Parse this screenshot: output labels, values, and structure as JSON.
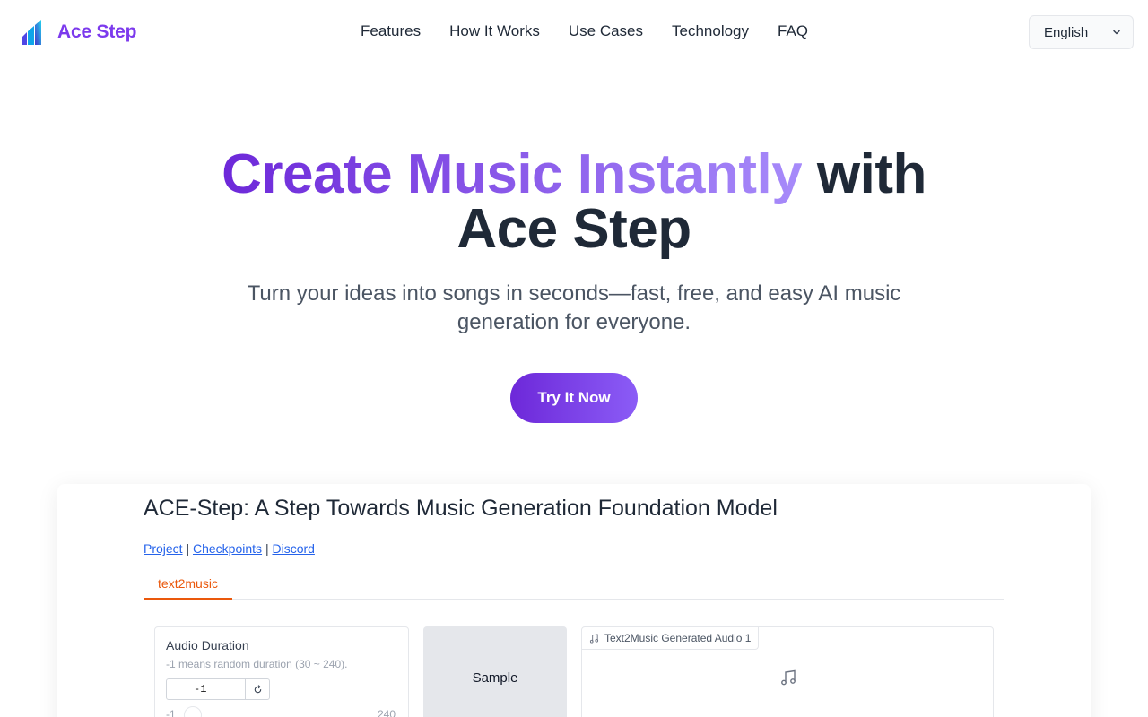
{
  "brand": {
    "name": "Ace Step"
  },
  "nav": {
    "links": [
      "Features",
      "How It Works",
      "Use Cases",
      "Technology",
      "FAQ"
    ],
    "language": "English"
  },
  "hero": {
    "title_gradient": "Create Music Instantly",
    "title_rest_1": "with",
    "title_rest_2": "Ace Step",
    "subtitle": "Turn your ideas into songs in seconds—fast, free, and easy AI music generation for everyone.",
    "cta": "Try It Now"
  },
  "app": {
    "title": "ACE-Step: A Step Towards Music Generation Foundation Model",
    "links": [
      "Project",
      "Checkpoints",
      "Discord"
    ],
    "separator": "|",
    "tab": "text2music",
    "duration": {
      "label": "Audio Duration",
      "info": "-1 means random duration (30 ~ 240).",
      "value": "-1",
      "min": "-1",
      "max": "240"
    },
    "sample_label": "Sample",
    "audio_label": "Text2Music Generated Audio 1"
  },
  "colors": {
    "accent": "#7c3aed",
    "tab_active": "#ea580c",
    "link": "#2563eb"
  }
}
